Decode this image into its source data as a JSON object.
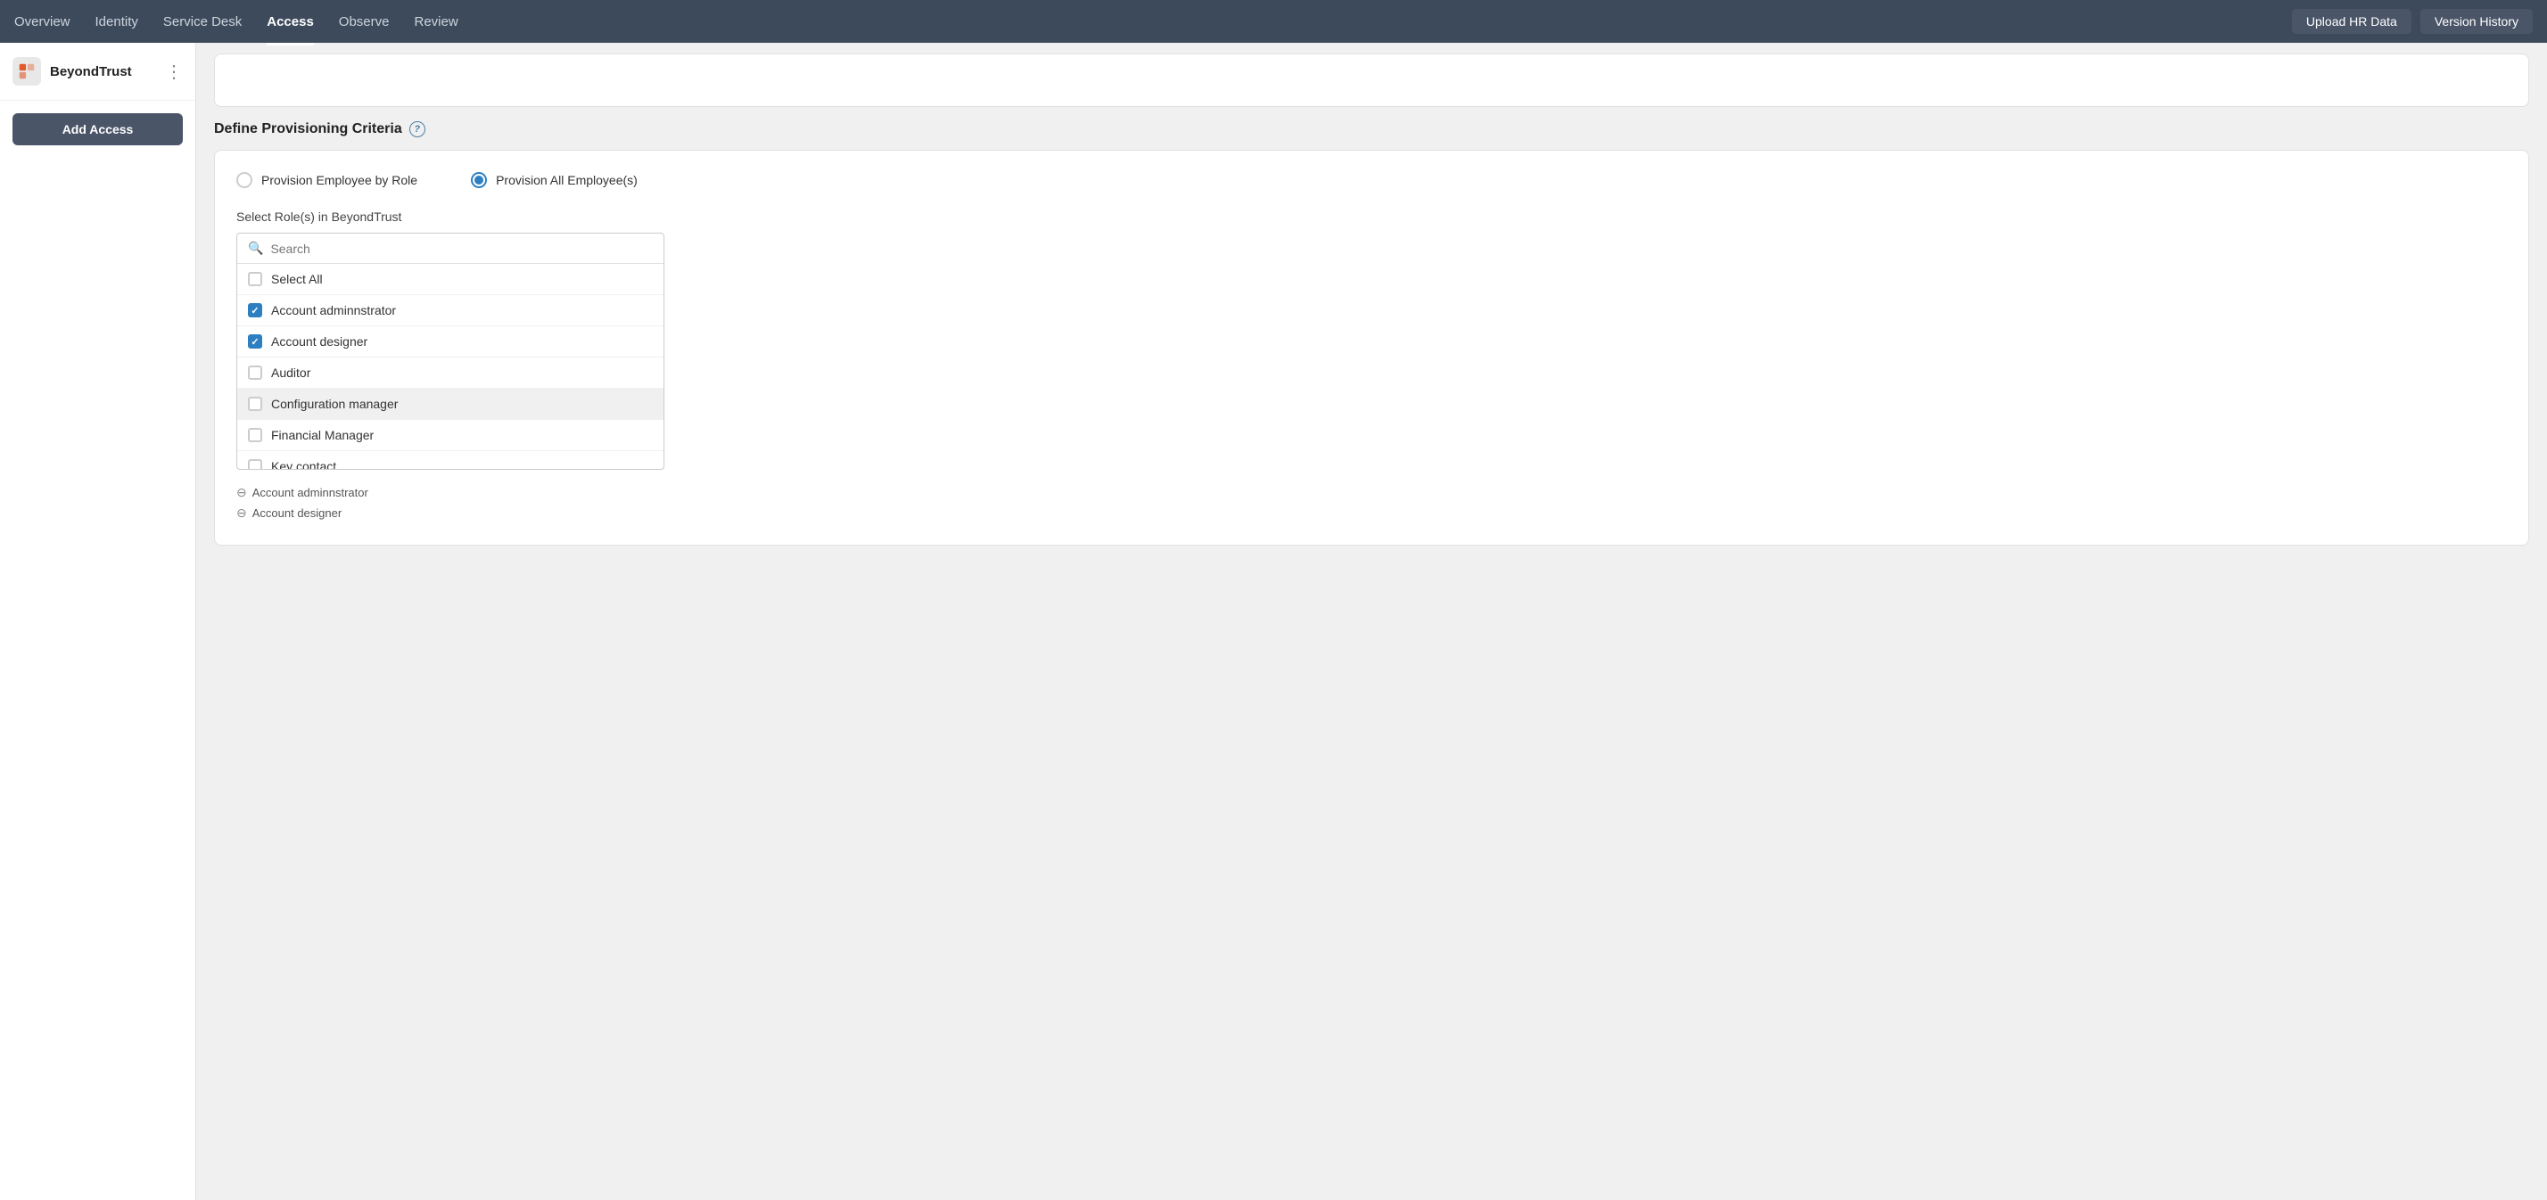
{
  "nav": {
    "items": [
      {
        "label": "Overview",
        "active": false
      },
      {
        "label": "Identity",
        "active": false
      },
      {
        "label": "Service Desk",
        "active": false
      },
      {
        "label": "Access",
        "active": true
      },
      {
        "label": "Observe",
        "active": false
      },
      {
        "label": "Review",
        "active": false
      }
    ],
    "upload_btn": "Upload HR Data",
    "version_btn": "Version History"
  },
  "sidebar": {
    "brand": "BeyondTrust",
    "add_access_btn": "Add Access"
  },
  "section": {
    "title": "Define Provisioning Criteria",
    "help_icon": "?"
  },
  "radio_options": [
    {
      "id": "by_role",
      "label": "Provision Employee by Role",
      "selected": false
    },
    {
      "id": "all_employees",
      "label": "Provision All Employee(s)",
      "selected": true
    }
  ],
  "roles": {
    "label": "Select Role(s) in BeyondTrust",
    "search_placeholder": "Search",
    "items": [
      {
        "label": "Select All",
        "checked": false,
        "highlighted": false
      },
      {
        "label": "Account adminnstrator",
        "checked": true,
        "highlighted": false
      },
      {
        "label": "Account designer",
        "checked": true,
        "highlighted": false
      },
      {
        "label": "Auditor",
        "checked": false,
        "highlighted": false
      },
      {
        "label": "Configuration manager",
        "checked": false,
        "highlighted": true
      },
      {
        "label": "Financial Manager",
        "checked": false,
        "highlighted": false
      },
      {
        "label": "Key contact",
        "checked": false,
        "highlighted": false
      }
    ],
    "selected_tags": [
      {
        "label": "Account adminnstrator"
      },
      {
        "label": "Account designer"
      }
    ]
  }
}
